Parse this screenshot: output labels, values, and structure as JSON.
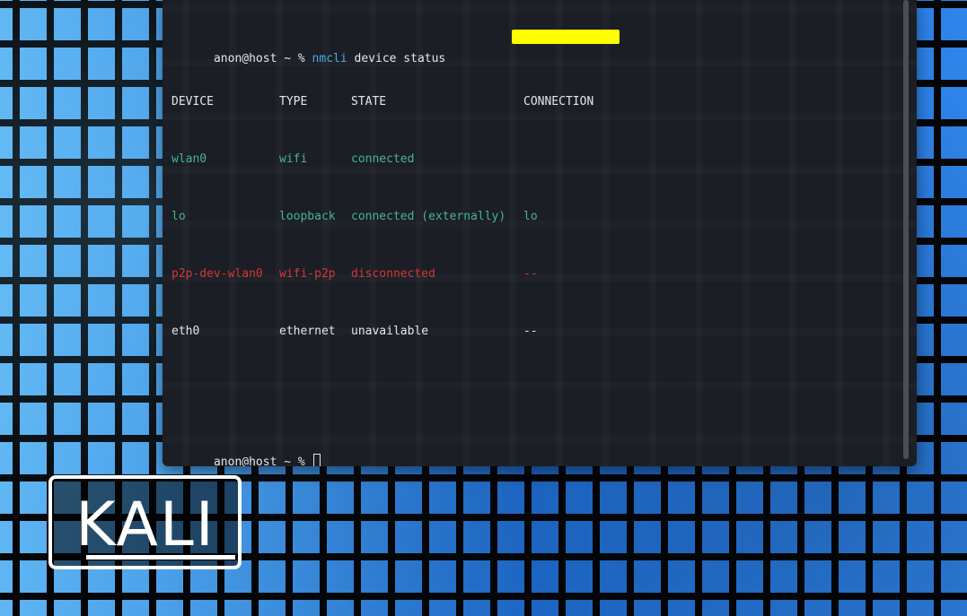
{
  "terminal": {
    "command_line": {
      "prompt": "anon@host ~ % ",
      "command": "nmcli",
      "args": " device status"
    },
    "table": {
      "headers": {
        "device": "DEVICE",
        "type": "TYPE",
        "state": "STATE",
        "connection": "CONNECTION"
      },
      "rows": [
        {
          "device": "wlan0",
          "type": "wifi",
          "state": "connected",
          "connection": ""
        },
        {
          "device": "lo",
          "type": "loopback",
          "state": "connected (externally)",
          "connection": "lo"
        },
        {
          "device": "p2p-dev-wlan0",
          "type": "wifi-p2p",
          "state": "disconnected",
          "connection": "--"
        },
        {
          "device": "eth0",
          "type": "ethernet",
          "state": "unavailable",
          "connection": "--"
        }
      ]
    },
    "next_prompt": "anon@host ~ % "
  },
  "colors": {
    "terminal_bg": "#1b1e24",
    "green": "#47b39c",
    "red": "#d2383a",
    "command_blue": "#4ea6e6",
    "highlight": "#ffff00",
    "wallpaper_blue": "#1f6fd6"
  },
  "logo": {
    "text": "KALI"
  }
}
